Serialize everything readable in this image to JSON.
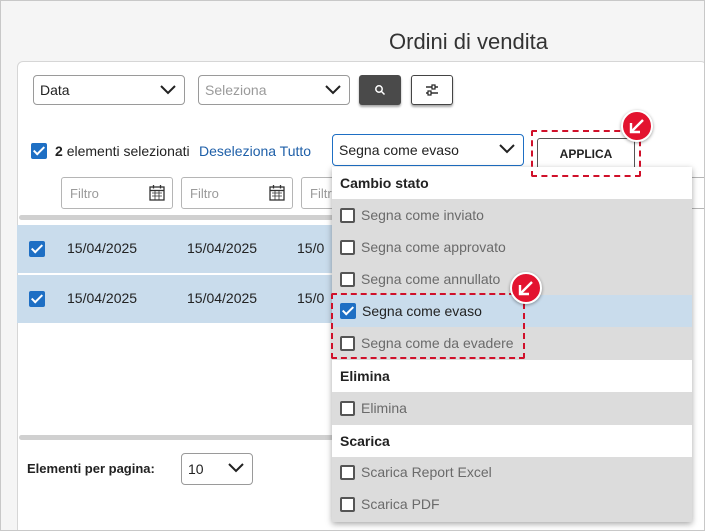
{
  "page": {
    "title": "Ordini di vendita"
  },
  "toolbar": {
    "date_select": "Data",
    "field_select_placeholder": "Seleziona"
  },
  "selection": {
    "count": "2",
    "label": "elementi selezionati",
    "deselect_all": "Deseleziona Tutto",
    "action_select": "Segna come evaso",
    "apply": "APPLICA"
  },
  "filters": {
    "placeholder": "Filtro"
  },
  "rows": [
    {
      "col1": "15/04/2025",
      "col2": "15/04/2025",
      "col3": "15/0"
    },
    {
      "col1": "15/04/2025",
      "col2": "15/04/2025",
      "col3": "15/0"
    }
  ],
  "pagination": {
    "label": "Elementi per pagina:",
    "value": "10"
  },
  "dropdown": {
    "groups": [
      {
        "label": "Cambio stato",
        "items": [
          "Segna come inviato",
          "Segna come approvato",
          "Segna come annullato",
          "Segna come evaso",
          "Segna come da evadere"
        ]
      },
      {
        "label": "Elimina",
        "items": [
          "Elimina"
        ]
      },
      {
        "label": "Scarica",
        "items": [
          "Scarica Report Excel",
          "Scarica PDF"
        ]
      }
    ],
    "selected_item": "Segna come evaso"
  },
  "colors": {
    "accent": "#1e6fc4",
    "highlight": "#e3132f",
    "row_selected": "#c9dcec"
  }
}
